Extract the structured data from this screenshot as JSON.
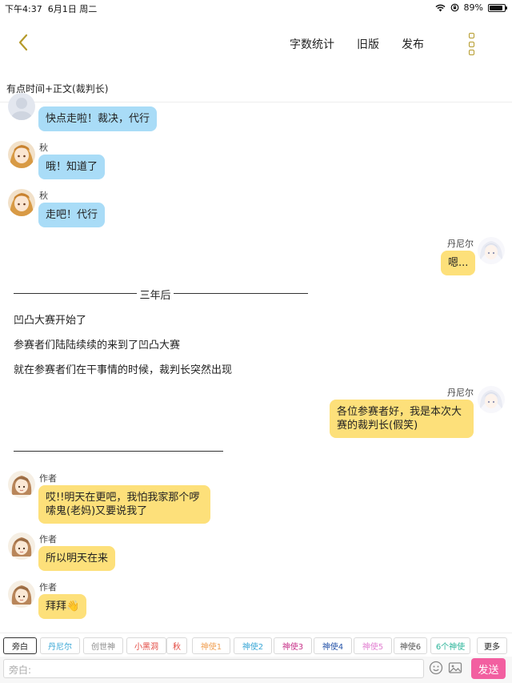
{
  "status_bar": {
    "time": "下午4:37",
    "date": "6月1日 周二",
    "battery": "89%",
    "battery_level": 0.89
  },
  "nav": {
    "word_count": "字数统计",
    "old_version": "旧版",
    "publish": "发布"
  },
  "chapter_title": "有点时间+正文(裁判长)",
  "messages": [
    {
      "text": "快点走啦！裁决，代行"
    },
    {
      "sender": "秋",
      "text": "哦！知道了"
    },
    {
      "sender": "秋",
      "text": "走吧！代行"
    },
    {
      "sender": "丹尼尔",
      "text": "嗯..."
    }
  ],
  "separator_label": "三年后",
  "narration": [
    "凹凸大赛开始了",
    "参赛者们陆陆续续的来到了凹凸大赛",
    "就在参赛者们在干事情的时候，裁判长突然出现"
  ],
  "messages_2": [
    {
      "sender": "丹尼尔",
      "line1": "各位参赛者好，我是本次大",
      "line2": "赛的裁判长(假笑)"
    },
    {
      "sender": "作者",
      "line1": "哎!!明天在更吧，我怕我家那个啰",
      "line2": "嗦鬼(老妈)又要说我了"
    },
    {
      "sender": "作者",
      "text": "所以明天在来"
    },
    {
      "sender": "作者",
      "text": "拜拜",
      "emoji": "👋"
    }
  ],
  "roles": [
    {
      "label": "旁白",
      "color": "#222222"
    },
    {
      "label": "丹尼尔",
      "color": "#3aa7d6"
    },
    {
      "label": "创世神",
      "color": "#8c8c8c"
    },
    {
      "label": "小黑洞",
      "color": "#e2463f"
    },
    {
      "label": "秋",
      "color": "#e2463f"
    },
    {
      "label": "神使1",
      "color": "#f0a155"
    },
    {
      "label": "神使2",
      "color": "#3aa7d6"
    },
    {
      "label": "神使3",
      "color": "#c8338a"
    },
    {
      "label": "神使4",
      "color": "#2553a8"
    },
    {
      "label": "神使5",
      "color": "#e27fd1"
    },
    {
      "label": "神使6",
      "color": "#555555"
    },
    {
      "label": "6个神使",
      "color": "#2db59a"
    },
    {
      "label": "更多",
      "color": "#222222"
    }
  ],
  "input": {
    "placeholder": "旁白:",
    "send": "发送"
  },
  "colors": {
    "accent": "#f25fa0",
    "blue_bubble": "#a9dcf7",
    "yellow_bubble": "#fde07a",
    "icon_gold": "#b59a2a"
  }
}
